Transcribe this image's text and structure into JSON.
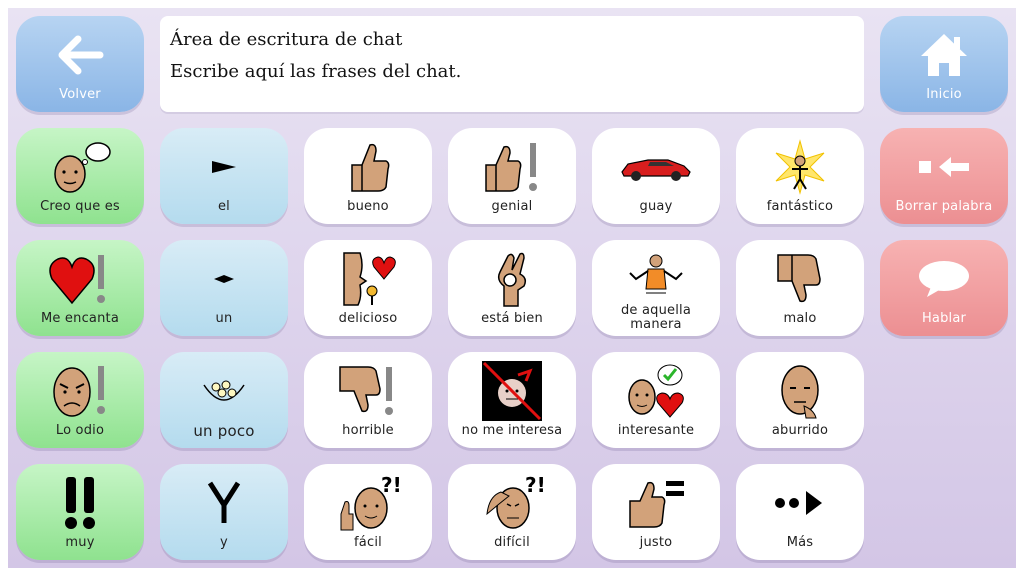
{
  "chat": {
    "title": "Área de escritura de chat",
    "placeholder": "Escribe aquí las frases del chat."
  },
  "nav": {
    "back_label": "Volver",
    "home_label": "Inicio",
    "delete_label": "Borrar palabra",
    "speak_label": "Hablar"
  },
  "grid": {
    "row1": [
      "Creo que es",
      "el",
      "bueno",
      "genial",
      "guay",
      "fantástico"
    ],
    "row2": [
      "Me encanta",
      "un",
      "delicioso",
      "está bien",
      "de aquella manera",
      "malo"
    ],
    "row3": [
      "Lo odio",
      "un poco",
      "horrible",
      "no me interesa",
      "interesante",
      "aburrido"
    ],
    "row4": [
      "muy",
      "y",
      "fácil",
      "difícil",
      "justo",
      "Más"
    ]
  },
  "colors": {
    "green_tile": "#8fe28f",
    "blue_tile": "#b4dbee",
    "nav_tile": "#8ab5e6",
    "red_tile": "#ec8f92",
    "background": "#d3c6e6"
  }
}
